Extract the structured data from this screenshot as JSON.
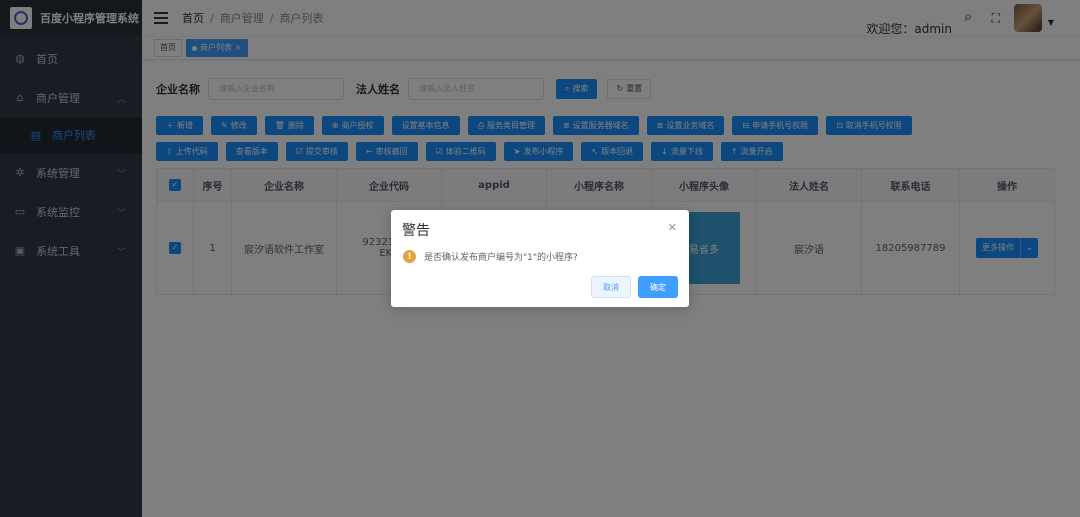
{
  "app": {
    "title": "百度小程序管理系统"
  },
  "sidebar": {
    "items": [
      {
        "label": "首页",
        "icon": "dashboard-icon"
      },
      {
        "label": "商户管理",
        "icon": "shop-icon",
        "expanded": true,
        "children": [
          {
            "label": "商户列表",
            "icon": "list-icon",
            "active": true
          }
        ]
      },
      {
        "label": "系统管理",
        "icon": "gear-icon"
      },
      {
        "label": "系统监控",
        "icon": "monitor-icon"
      },
      {
        "label": "系统工具",
        "icon": "toolbox-icon"
      }
    ]
  },
  "header": {
    "breadcrumb": [
      "首页",
      "商户管理",
      "商户列表"
    ],
    "welcome": "欢迎您：admin"
  },
  "tags": {
    "home": "首页",
    "active": "商户列表"
  },
  "search": {
    "company_label": "企业名称",
    "company_placeholder": "请输入企业名称",
    "legal_label": "法人姓名",
    "legal_placeholder": "请输入法人姓名",
    "search_btn": "搜索",
    "reset_btn": "重置"
  },
  "toolbar": {
    "row1": [
      "新增",
      "修改",
      "删除",
      "商户授权",
      "设置基本信息",
      "服务类目管理",
      "设置服务器域名",
      "设置业务域名",
      "申请手机号权限",
      "取消手机号权限"
    ],
    "row2": [
      "上传代码",
      "查看版本",
      "提交审核",
      "审核撤回",
      "体验二维码",
      "发布小程序",
      "版本回退",
      "流量下线",
      "流量开启"
    ]
  },
  "table": {
    "headers": [
      "序号",
      "企业名称",
      "企业代码",
      "appid",
      "小程序名称",
      "小程序头像",
      "法人姓名",
      "联系电话",
      "操作"
    ],
    "rows": [
      {
        "index": "1",
        "company": "宸汐语软件工作室",
        "code_line1": "923214M5",
        "code_line2": "EKC",
        "avatar_text": "易省多",
        "legal": "宸汐语",
        "phone": "18205987789",
        "action": "更多操作"
      }
    ]
  },
  "dialog": {
    "title": "警告",
    "message": "是否确认发布商户编号为\"1\"的小程序?",
    "cancel": "取消",
    "confirm": "确定"
  },
  "colors": {
    "primary": "#1890ff",
    "sidebar": "#2f3a45",
    "warning": "#e6a23c"
  }
}
